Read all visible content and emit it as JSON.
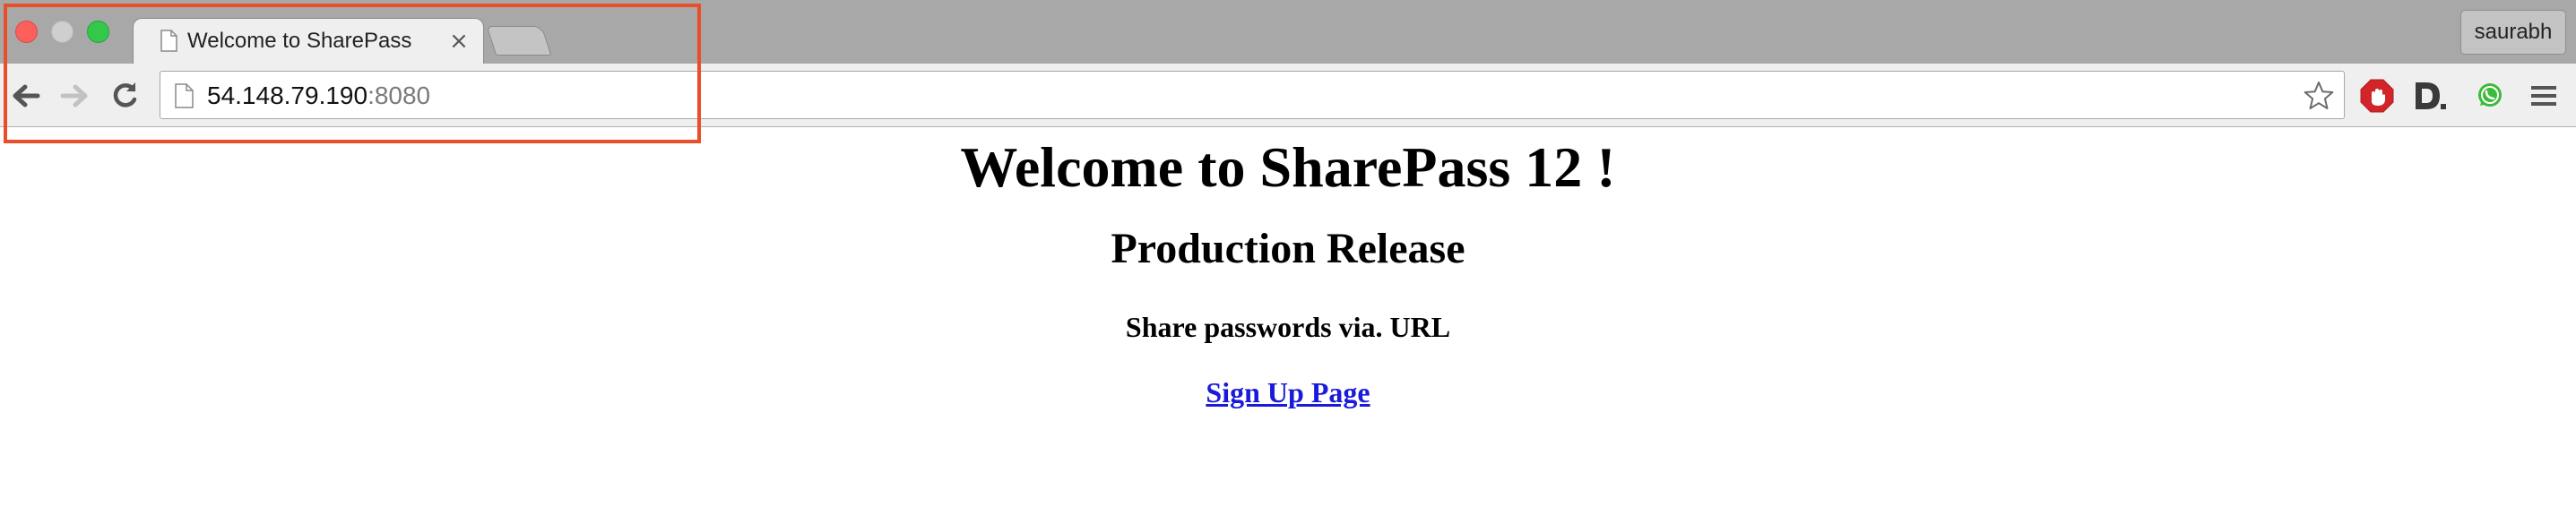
{
  "window": {
    "traffic_lights": [
      "close",
      "minimize",
      "maximize"
    ],
    "profile_name": "saurabh"
  },
  "tabs": [
    {
      "title": "Welcome to SharePass",
      "active": true,
      "icon": "page-icon",
      "close_glyph": "×"
    }
  ],
  "toolbar": {
    "back_icon": "back-arrow-icon",
    "forward_icon": "forward-arrow-icon",
    "reload_icon": "reload-icon",
    "address": {
      "host": "54.148.79.190",
      "port": ":8080"
    },
    "bookmark_icon": "star-icon",
    "extensions": [
      "adblock-icon",
      "d-extension-icon",
      "whatsapp-icon",
      "menu-icon"
    ]
  },
  "annotation": {
    "color": "#e94e2a"
  },
  "page": {
    "heading": "Welcome to SharePass 12 !",
    "subheading": "Production Release",
    "tagline": "Share passwords via. URL",
    "signup_link": "Sign Up Page"
  },
  "colors": {
    "tabstrip_bg": "#a8a8a8",
    "toolbar_bg": "#efefef",
    "link": "#1a1adb"
  }
}
